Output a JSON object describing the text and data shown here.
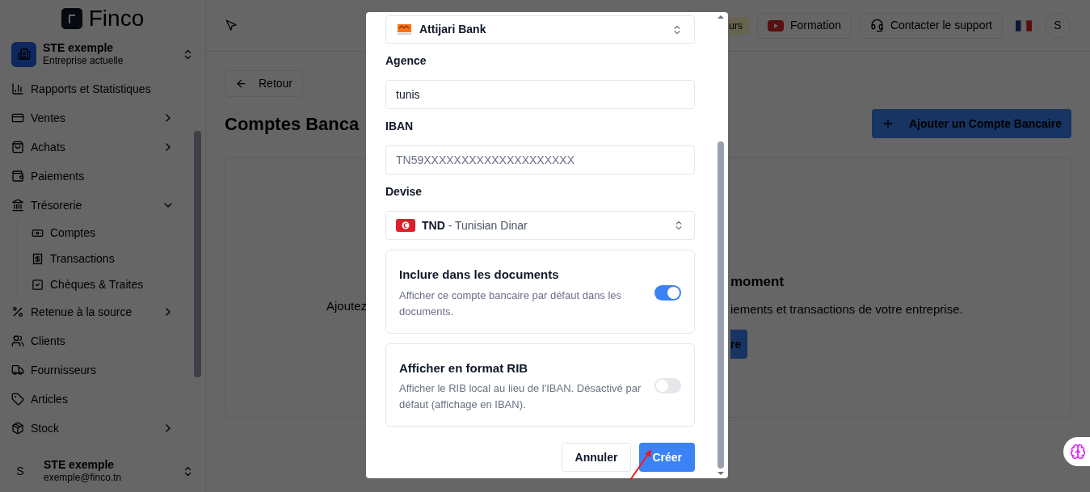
{
  "sidebar": {
    "logo": "Finco",
    "company": {
      "name": "STE exemple",
      "subtitle": "Entreprise actuelle"
    },
    "items": [
      {
        "label": "Rapports et Statistiques",
        "kind": "link"
      },
      {
        "label": "Ventes",
        "kind": "group",
        "expanded": false
      },
      {
        "label": "Achats",
        "kind": "group",
        "expanded": false
      },
      {
        "label": "Paiements",
        "kind": "link"
      },
      {
        "label": "Trésorerie",
        "kind": "group",
        "expanded": true,
        "children": [
          {
            "label": "Comptes"
          },
          {
            "label": "Transactions"
          },
          {
            "label": "Chèques & Traites"
          }
        ]
      },
      {
        "label": "Retenue à la source",
        "kind": "group",
        "expanded": false
      },
      {
        "label": "Clients",
        "kind": "link"
      },
      {
        "label": "Fournisseurs",
        "kind": "link"
      },
      {
        "label": "Articles",
        "kind": "link"
      },
      {
        "label": "Stock",
        "kind": "group",
        "expanded": false
      }
    ],
    "user": {
      "avatar": "S",
      "name": "STE exemple",
      "email": "exemple@finco.tn"
    }
  },
  "topbar": {
    "badge": "urs",
    "buttons": [
      {
        "label": "Formation"
      },
      {
        "label": "Contacter le support"
      }
    ],
    "avatar": "S"
  },
  "page": {
    "back": "Retour",
    "title": "Comptes Banca",
    "add_button": "Ajouter un Compte Bancaire",
    "empty": {
      "text_left": "Ajoutez",
      "title_right": "moment",
      "text_right": "iements et transactions de votre entreprise.",
      "button_right": "re"
    }
  },
  "modal": {
    "bank": "Attijari Bank",
    "fields": [
      {
        "label": "Agence",
        "value": "tunis"
      },
      {
        "label": "IBAN",
        "placeholder": "TN59XXXXXXXXXXXXXXXXXXXX"
      }
    ],
    "currency": {
      "label": "Devise",
      "code": "TND",
      "separator": "-",
      "name": "Tunisian Dinar"
    },
    "toggles": [
      {
        "title": "Inclure dans les documents",
        "description": "Afficher ce compte bancaire par défaut dans les documents.",
        "on": true
      },
      {
        "title": "Afficher en format RIB",
        "description": "Afficher le RIB local au lieu de l'IBAN. Désactivé par défaut (affichage en IBAN).",
        "on": false
      }
    ],
    "cancel": "Annuler",
    "create": "Créer"
  }
}
